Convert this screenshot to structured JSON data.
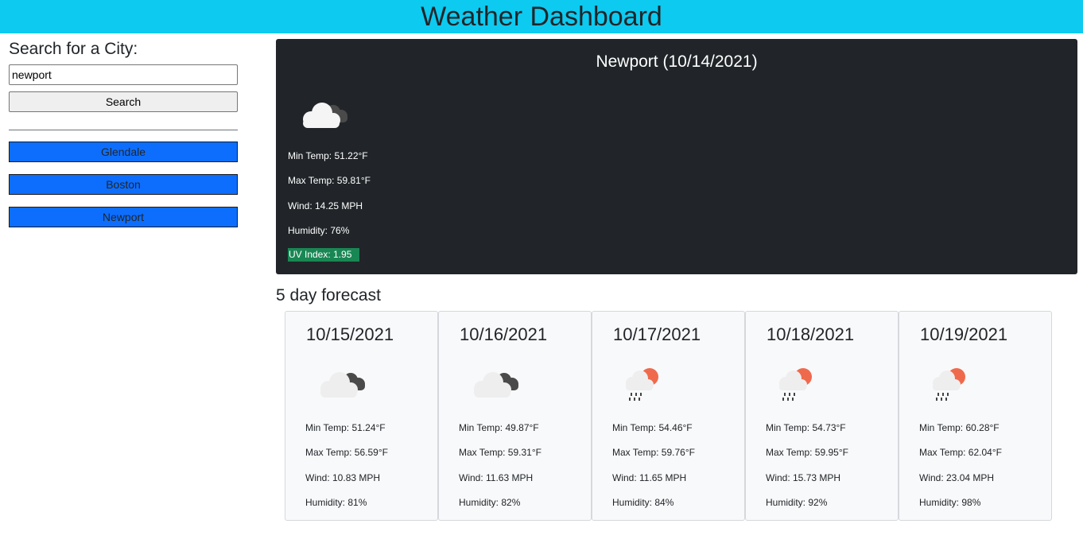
{
  "header": {
    "title": "Weather Dashboard"
  },
  "search": {
    "label": "Search for a City:",
    "input_value": "newport",
    "button_label": "Search"
  },
  "history": [
    {
      "label": "Glendale"
    },
    {
      "label": "Boston"
    },
    {
      "label": "Newport"
    }
  ],
  "current": {
    "title": "Newport (10/14/2021)",
    "icon": "cloudy-icon",
    "min_temp": "Min Temp: 51.22°F",
    "max_temp": "Max Temp: 59.81°F",
    "wind": "Wind: 14.25 MPH",
    "humidity": "Humidity: 76%",
    "uv": "UV Index: 1.95",
    "uv_color": "#198754"
  },
  "forecast": {
    "heading": "5 day forecast",
    "days": [
      {
        "date": "10/15/2021",
        "icon": "cloudy-icon",
        "min_temp": "Min Temp: 51.24°F",
        "max_temp": "Max Temp: 56.59°F",
        "wind": "Wind: 10.83 MPH",
        "humidity": "Humidity: 81%"
      },
      {
        "date": "10/16/2021",
        "icon": "cloudy-icon",
        "min_temp": "Min Temp: 49.87°F",
        "max_temp": "Max Temp: 59.31°F",
        "wind": "Wind: 11.63 MPH",
        "humidity": "Humidity: 82%"
      },
      {
        "date": "10/17/2021",
        "icon": "sun-rain-icon",
        "min_temp": "Min Temp: 54.46°F",
        "max_temp": "Max Temp: 59.76°F",
        "wind": "Wind: 11.65 MPH",
        "humidity": "Humidity: 84%"
      },
      {
        "date": "10/18/2021",
        "icon": "sun-rain-icon",
        "min_temp": "Min Temp: 54.73°F",
        "max_temp": "Max Temp: 59.95°F",
        "wind": "Wind: 15.73 MPH",
        "humidity": "Humidity: 92%"
      },
      {
        "date": "10/19/2021",
        "icon": "sun-rain-icon",
        "min_temp": "Min Temp: 60.28°F",
        "max_temp": "Max Temp: 62.04°F",
        "wind": "Wind: 23.04 MPH",
        "humidity": "Humidity: 98%"
      }
    ]
  },
  "colors": {
    "header_bg": "#0dcaf0",
    "history_button_bg": "#0d6efd",
    "current_panel_bg": "#212529",
    "card_bg": "#f8f9fa",
    "sun": "#ef6a4d"
  }
}
